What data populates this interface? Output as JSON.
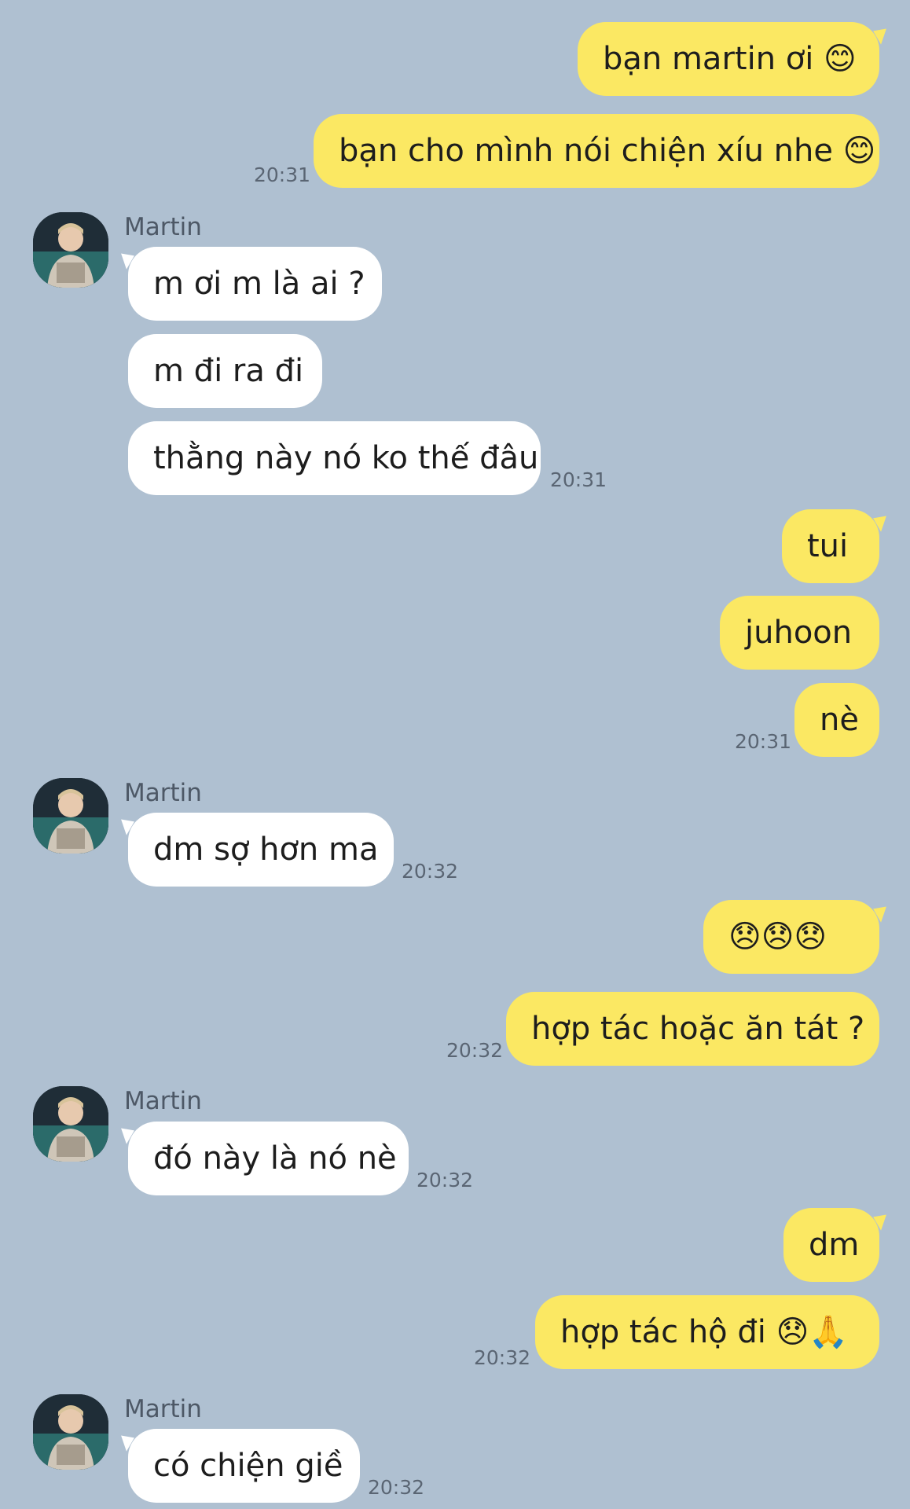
{
  "contact": {
    "name": "Martin"
  },
  "messages": [
    {
      "side": "out",
      "text": "bạn martin ơi 😊"
    },
    {
      "side": "out",
      "text": "bạn cho mình nói chiện xíu nhe 😊",
      "time": "20:31"
    },
    {
      "side": "in",
      "text": "m ơi m là ai ?"
    },
    {
      "side": "in",
      "text": "m đi ra đi"
    },
    {
      "side": "in",
      "text": "thằng này nó ko thế đâu",
      "time": "20:31"
    },
    {
      "side": "out",
      "text": "tui"
    },
    {
      "side": "out",
      "text": "juhoon"
    },
    {
      "side": "out",
      "text": "nè",
      "time": "20:31"
    },
    {
      "side": "in",
      "text": "dm sợ hơn ma",
      "time": "20:32"
    },
    {
      "side": "out",
      "text": "😞😞😞"
    },
    {
      "side": "out",
      "text": "hợp tác hoặc ăn tát ?",
      "time": "20:32"
    },
    {
      "side": "in",
      "text": "đó này là nó nè",
      "time": "20:32"
    },
    {
      "side": "out",
      "text": "dm"
    },
    {
      "side": "out",
      "text": "hợp tác hộ đi 😞🙏",
      "time": "20:32"
    },
    {
      "side": "in",
      "text": "có chiện giề",
      "time": "20:32"
    }
  ],
  "colors": {
    "background": "#afc0d1",
    "outgoing_bubble": "#fbe863",
    "incoming_bubble": "#ffffff"
  },
  "icons": {
    "avatar": "profile-photo-avatar"
  }
}
